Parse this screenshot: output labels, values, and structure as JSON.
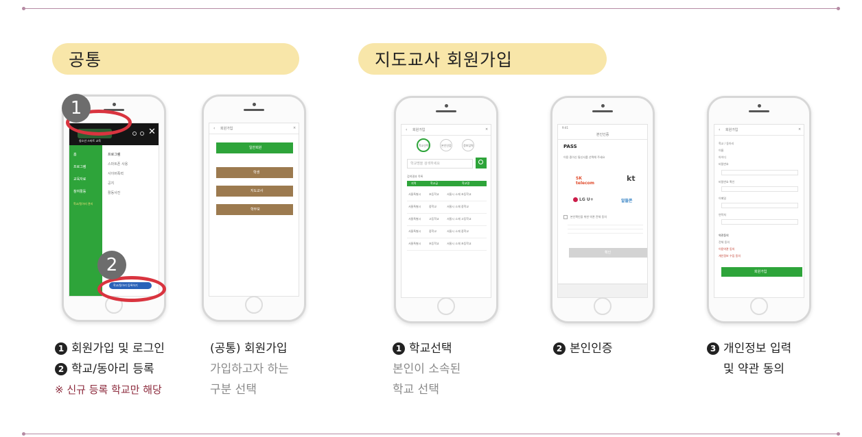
{
  "sections": {
    "common": "공통",
    "teacher": "지도교사 회원가입"
  },
  "phone1": {
    "markers": [
      "1",
      "2"
    ],
    "logo_sub": "청소년 스마트 교육",
    "menu": [
      "홈",
      "프로그램",
      "교육자료",
      "참여활동",
      "학교/동아리 관리"
    ],
    "menu_right": [
      "프로그램",
      "스마트폰 사용",
      "사이버폭력",
      "공지",
      "활동사진"
    ],
    "register_btn": "학교/동아리 등록하기"
  },
  "phone2": {
    "title": "회원가입",
    "login_btn": "일반회원",
    "options": [
      "학생",
      "지도교사",
      "학부모"
    ]
  },
  "phone3": {
    "title": "회원가입",
    "steps": [
      "학교선택",
      "본인인증",
      "정보입력"
    ],
    "search_placeholder": "학교명을 검색하세요",
    "result_label": "검색결과 목록",
    "headers": [
      "지역",
      "학교급",
      "학교명"
    ],
    "rows": [
      [
        "서울특별시",
        "초등학교",
        "서울시 소재 초등학교"
      ],
      [
        "서울특별시",
        "중학교",
        "서울시 소재 중학교"
      ],
      [
        "서울특별시",
        "고등학교",
        "서울시 소재 고등학교"
      ],
      [
        "서울특별시",
        "중학교",
        "서울시 소재 중학교"
      ],
      [
        "서울특별시",
        "초등학교",
        "서울시 소재 초등학교"
      ]
    ]
  },
  "phone4": {
    "status": "9:41",
    "title": "본인인증",
    "brand": "PASS",
    "instruction": "이용 중이신 통신사를 선택해 주세요",
    "carriers": [
      "SK telecom",
      "kt",
      "LG U+",
      "알뜰폰"
    ],
    "agree": "본인확인을 위한 약관 전체 동의",
    "confirm": "확인"
  },
  "phone5": {
    "title": "회원가입",
    "fields": [
      "학교 / 동아리",
      "이름",
      "아이디",
      "비밀번호",
      "비밀번호 확인",
      "이메일",
      "연락처"
    ],
    "terms_title": "약관동의",
    "terms": [
      "전체 동의",
      "이용약관 동의",
      "개인정보 수집 동의"
    ],
    "submit": "회원가입"
  },
  "captions": {
    "c1_line1": "회원가입 및 로그인",
    "c1_line2": "학교/동아리 등록",
    "c1_note": "※ 신규 등록 학교만 해당",
    "c2_line1": "(공통) 회원가입",
    "c2_line2": "가입하고자 하는",
    "c2_line3": "구분 선택",
    "c3_line1": "학교선택",
    "c3_line2": "본인이 소속된",
    "c3_line3": "학교 선택",
    "c4_line1": "본인인증",
    "c5_line1": "개인정보 입력",
    "c5_line2": "및 약관 동의",
    "nums": [
      "1",
      "2",
      "1",
      "2",
      "3"
    ]
  },
  "colors": {
    "pill": "#f8e6a9",
    "green": "#2ea43a",
    "brown": "#9c7a4f",
    "red": "#d9343f",
    "warn": "#8c2a3c"
  }
}
